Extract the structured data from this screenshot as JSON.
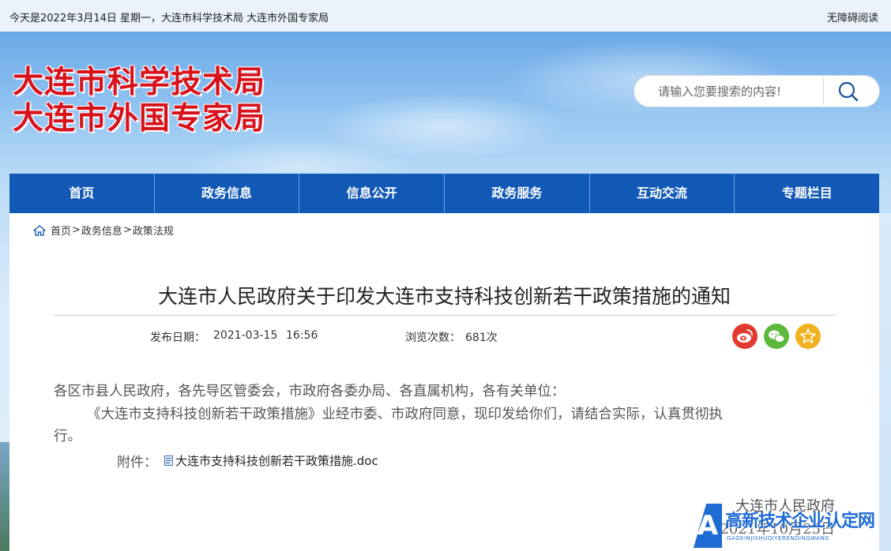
{
  "topbar": {
    "date_text": "今天是2022年3月14日 星期一，大连市科学技术局 大连市外国专家局",
    "accessibility": "无障碍阅读"
  },
  "header": {
    "logo_line1": "大连市科学技术局",
    "logo_line2": "大连市外国专家局",
    "logo_color": "#d8121b"
  },
  "search": {
    "placeholder": "请输入您要搜索的内容!",
    "icon": "search-icon"
  },
  "nav": {
    "items": [
      "首页",
      "政务信息",
      "信息公开",
      "政务服务",
      "互动交流",
      "专题栏目"
    ],
    "color": "#1259b6"
  },
  "breadcrumb": {
    "home_icon": "home-icon",
    "items": [
      "首页",
      "政务信息",
      "政策法规"
    ],
    "separator": ">"
  },
  "article": {
    "title": "大连市人民政府关于印发大连市支持科技创新若干政策措施的通知",
    "publish_label": "发布日期：",
    "publish_date": "2021-03-15",
    "publish_time": "16:56",
    "views_label": "浏览次数：",
    "views_value": "681次",
    "share": [
      "weibo-icon",
      "wechat-icon",
      "favorite-icon"
    ],
    "para1": "各区市县人民政府，各先导区管委会，市政府各委办局、各直属机构，各有关单位：",
    "para2_line1": "《大连市支持科技创新若干政策措施》业经市委、市政府同意，现印发给你们，请结合实际，认真贯彻执",
    "para2_line2": "行。",
    "attachment_label": "附件：",
    "attachment_file": "大连市支持科技创新若干政策措施.doc",
    "signature": "大连市人民政府",
    "signature_date": "2021年10月25日"
  },
  "watermark": {
    "logo_letter": "A",
    "title": "高新技术企业认定网",
    "subtitle": "GAOXINJISHUQIYERENDINGWANG"
  }
}
